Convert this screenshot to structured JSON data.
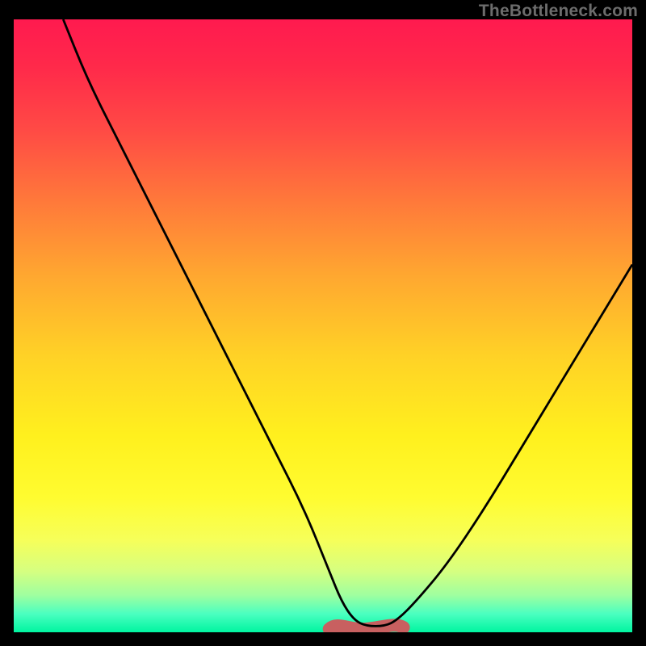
{
  "watermark": "TheBottleneck.com",
  "colors": {
    "gradient_top": "#ff1a4f",
    "gradient_mid": "#fff01e",
    "gradient_bottom": "#00f5a0",
    "curve": "#000000",
    "valley_marker": "#c86060"
  },
  "chart_data": {
    "type": "line",
    "title": "",
    "xlabel": "",
    "ylabel": "",
    "xlim": [
      0,
      100
    ],
    "ylim": [
      0,
      100
    ],
    "series": [
      {
        "name": "bottleneck-curve",
        "x": [
          8,
          12,
          17,
          22,
          27,
          32,
          37,
          42,
          47,
          51,
          53,
          55,
          57,
          60,
          62,
          65,
          70,
          76,
          82,
          88,
          94,
          100
        ],
        "values": [
          100,
          90,
          80,
          70,
          60,
          50,
          40,
          30,
          20,
          10,
          5,
          2,
          1,
          1,
          2,
          5,
          11,
          20,
          30,
          40,
          50,
          60
        ]
      }
    ],
    "valley": {
      "x_start": 51,
      "x_end": 63,
      "y": 0
    }
  }
}
